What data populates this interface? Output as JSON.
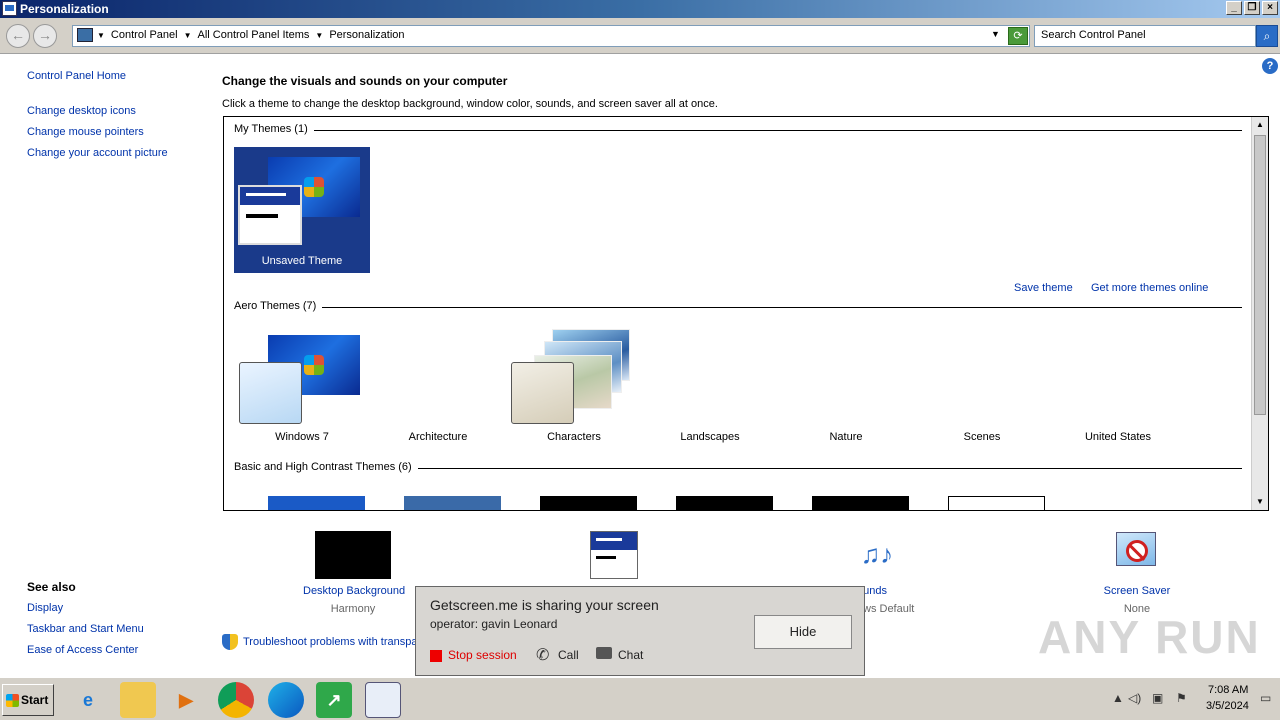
{
  "window": {
    "title": "Personalization"
  },
  "address": {
    "crumbs": [
      "Control Panel",
      "All Control Panel Items",
      "Personalization"
    ],
    "search_placeholder": "Search Control Panel"
  },
  "left_nav": {
    "home": "Control Panel Home",
    "links": [
      "Change desktop icons",
      "Change mouse pointers",
      "Change your account picture"
    ],
    "see_also_heading": "See also",
    "see_also": [
      "Display",
      "Taskbar and Start Menu",
      "Ease of Access Center"
    ]
  },
  "main": {
    "heading": "Change the visuals and sounds on your computer",
    "subheading": "Click a theme to change the desktop background, window color, sounds, and screen saver all at once.",
    "my_themes": {
      "title": "My Themes (1)",
      "themes": [
        "Unsaved Theme"
      ],
      "save_link": "Save theme",
      "more_link": "Get more themes online"
    },
    "aero_themes": {
      "title": "Aero Themes (7)",
      "themes": [
        "Windows 7",
        "Architecture",
        "Characters",
        "Landscapes",
        "Nature",
        "Scenes",
        "United States"
      ]
    },
    "basic_themes": {
      "title": "Basic and High Contrast Themes (6)"
    }
  },
  "settings": {
    "desktop_background": {
      "label": "Desktop Background",
      "value": "Harmony"
    },
    "sounds": {
      "label": "ounds",
      "value": "ws Default"
    },
    "screen_saver": {
      "label": "Screen Saver",
      "value": "None"
    }
  },
  "troubleshoot": "Troubleshoot problems with transpa",
  "popup": {
    "line1": "Getscreen.me is sharing your screen",
    "line2": "operator: gavin Leonard",
    "hide": "Hide",
    "stop": "Stop session",
    "call": "Call",
    "chat": "Chat"
  },
  "watermark": "ANY RUN",
  "taskbar": {
    "start": "Start",
    "time": "7:08 AM",
    "date": "3/5/2024"
  }
}
